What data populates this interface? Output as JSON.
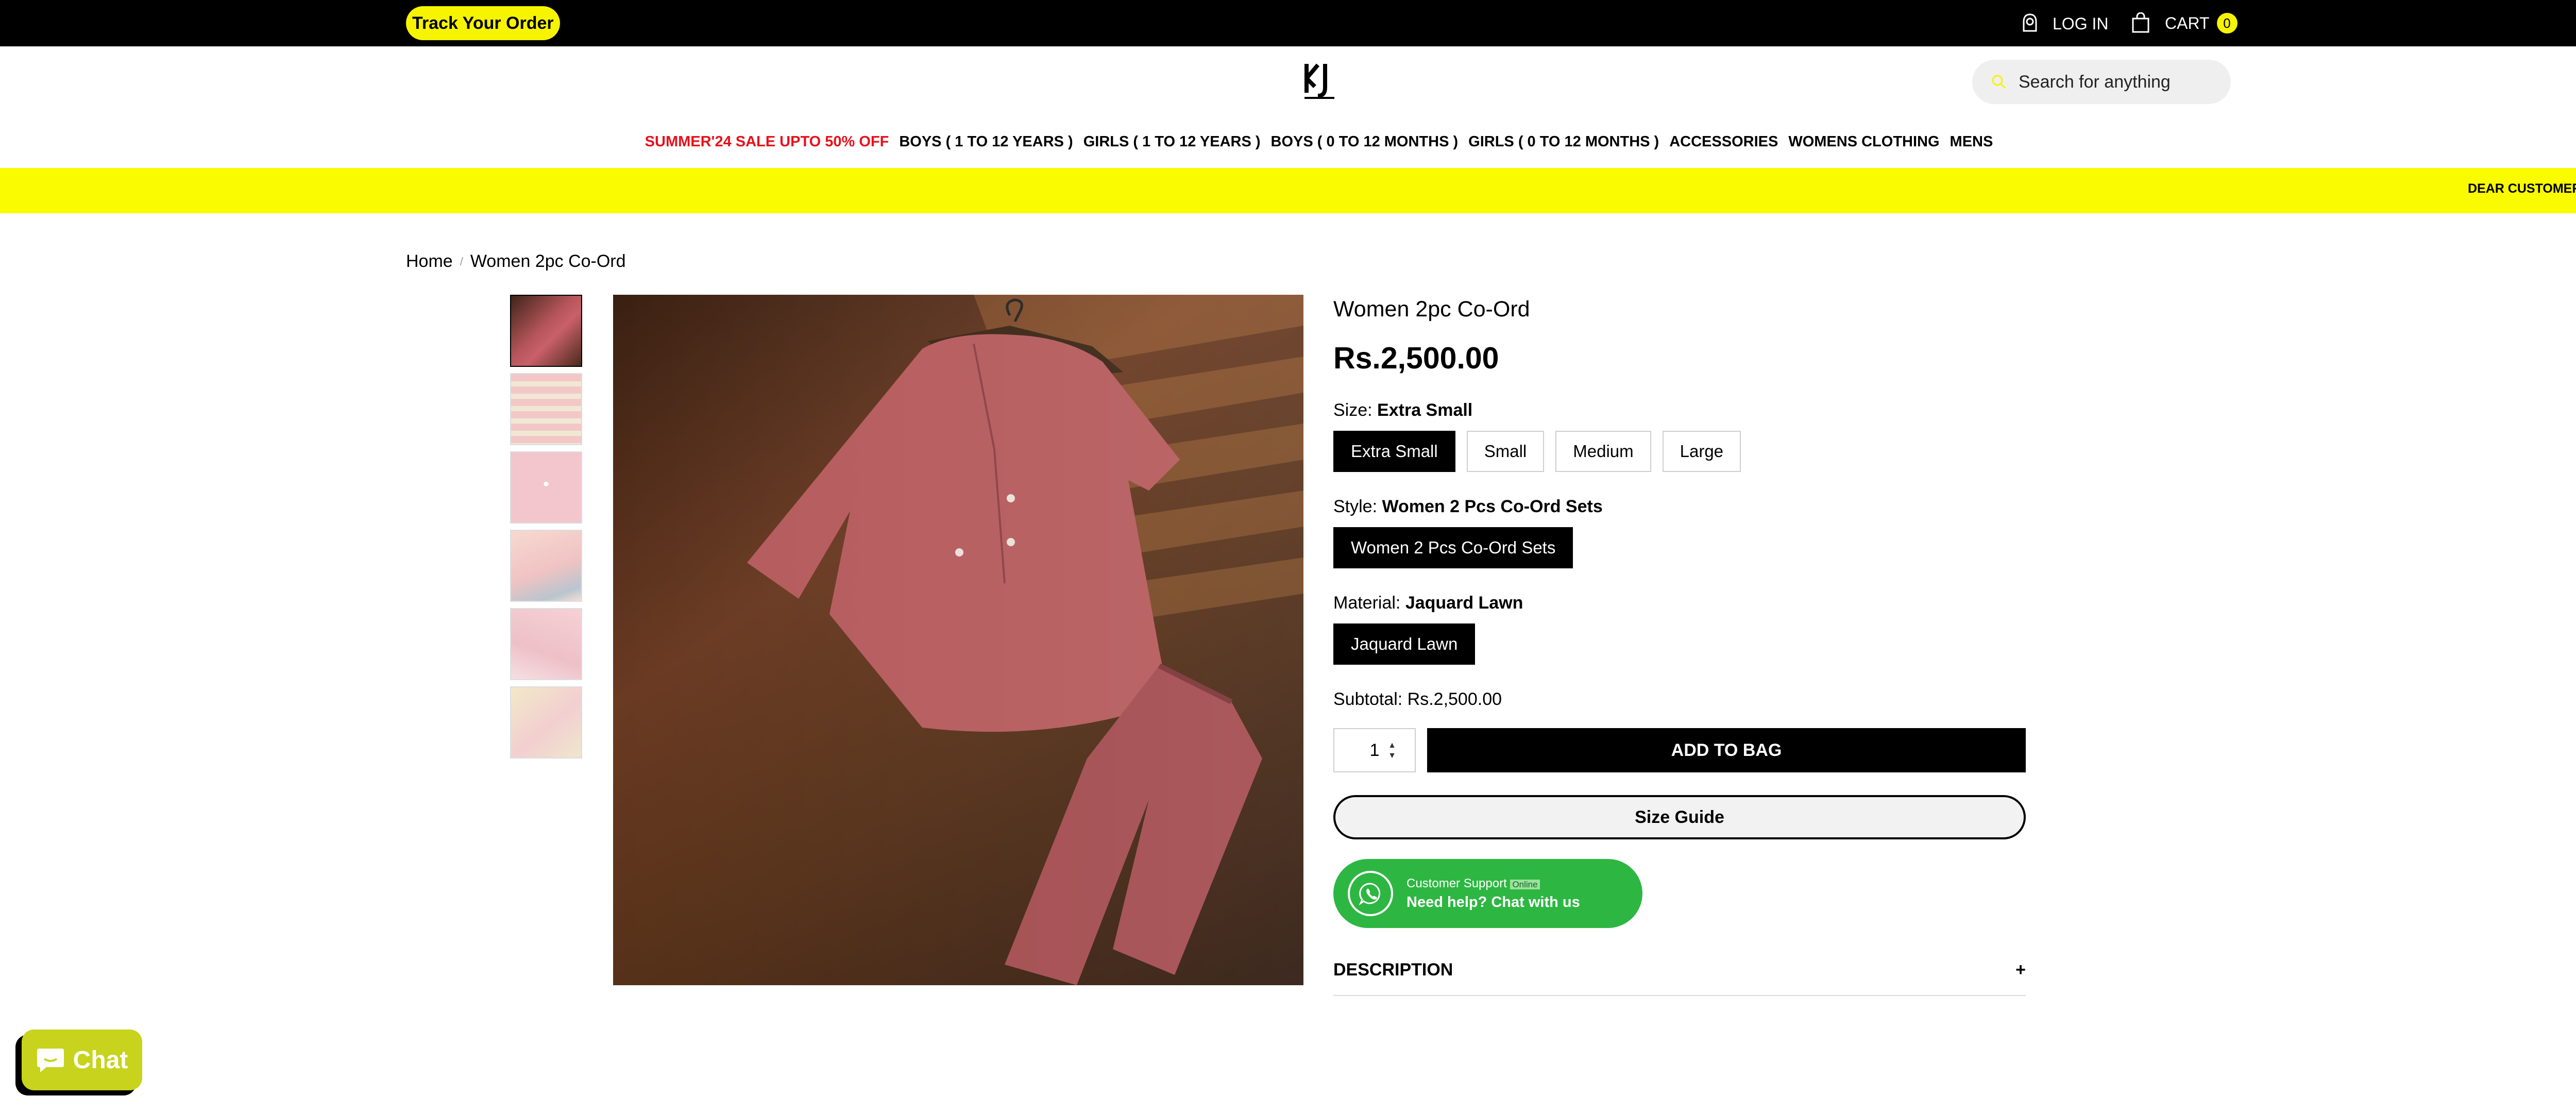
{
  "topbar": {
    "track_label": "Track Your Order",
    "login_label": "LOG IN",
    "cart_label": "CART",
    "cart_count": "0"
  },
  "header": {
    "logo_text": "KJ",
    "search_placeholder": "Search for anything"
  },
  "nav": {
    "items": [
      "SUMMER'24 SALE UPTO 50% OFF",
      "BOYS ( 1 TO 12 YEARS )",
      "GIRLS ( 1 TO 12 YEARS )",
      "BOYS ( 0 TO 12 MONTHS )",
      "GIRLS ( 0 TO 12 MONTHS )",
      "ACCESSORIES",
      "WOMENS CLOTHING",
      "MENS"
    ]
  },
  "promo": {
    "text": "DEAR CUSTOMERS, FO",
    "arrow": "›"
  },
  "breadcrumb": {
    "home": "Home",
    "current": "Women 2pc Co-Ord"
  },
  "product": {
    "title": "Women 2pc Co-Ord",
    "price": "Rs.2,500.00",
    "size_label": "Size:",
    "size_selected": "Extra Small",
    "sizes": [
      "Extra Small",
      "Small",
      "Medium",
      "Large"
    ],
    "style_label": "Style:",
    "style_selected": "Women 2 Pcs Co-Ord Sets",
    "styles": [
      "Women 2 Pcs Co-Ord Sets"
    ],
    "material_label": "Material:",
    "material_selected": "Jaquard Lawn",
    "materials": [
      "Jaquard Lawn"
    ],
    "subtotal_label": "Subtotal:",
    "subtotal_value": "Rs.2,500.00",
    "quantity": "1",
    "add_to_bag": "ADD TO BAG",
    "size_guide": "Size Guide",
    "description_label": "DESCRIPTION",
    "description_toggle": "+"
  },
  "whatsapp": {
    "support_label": "Customer Support",
    "status": "Online",
    "cta": "Need help? Chat with us"
  },
  "chat": {
    "label": "Chat"
  },
  "colors": {
    "accent_yellow": "#f6f400",
    "promo_yellow": "#fafa00",
    "sale_red": "#e8101a",
    "whatsapp_green": "#2db742",
    "chat_green": "#c7d31c"
  }
}
